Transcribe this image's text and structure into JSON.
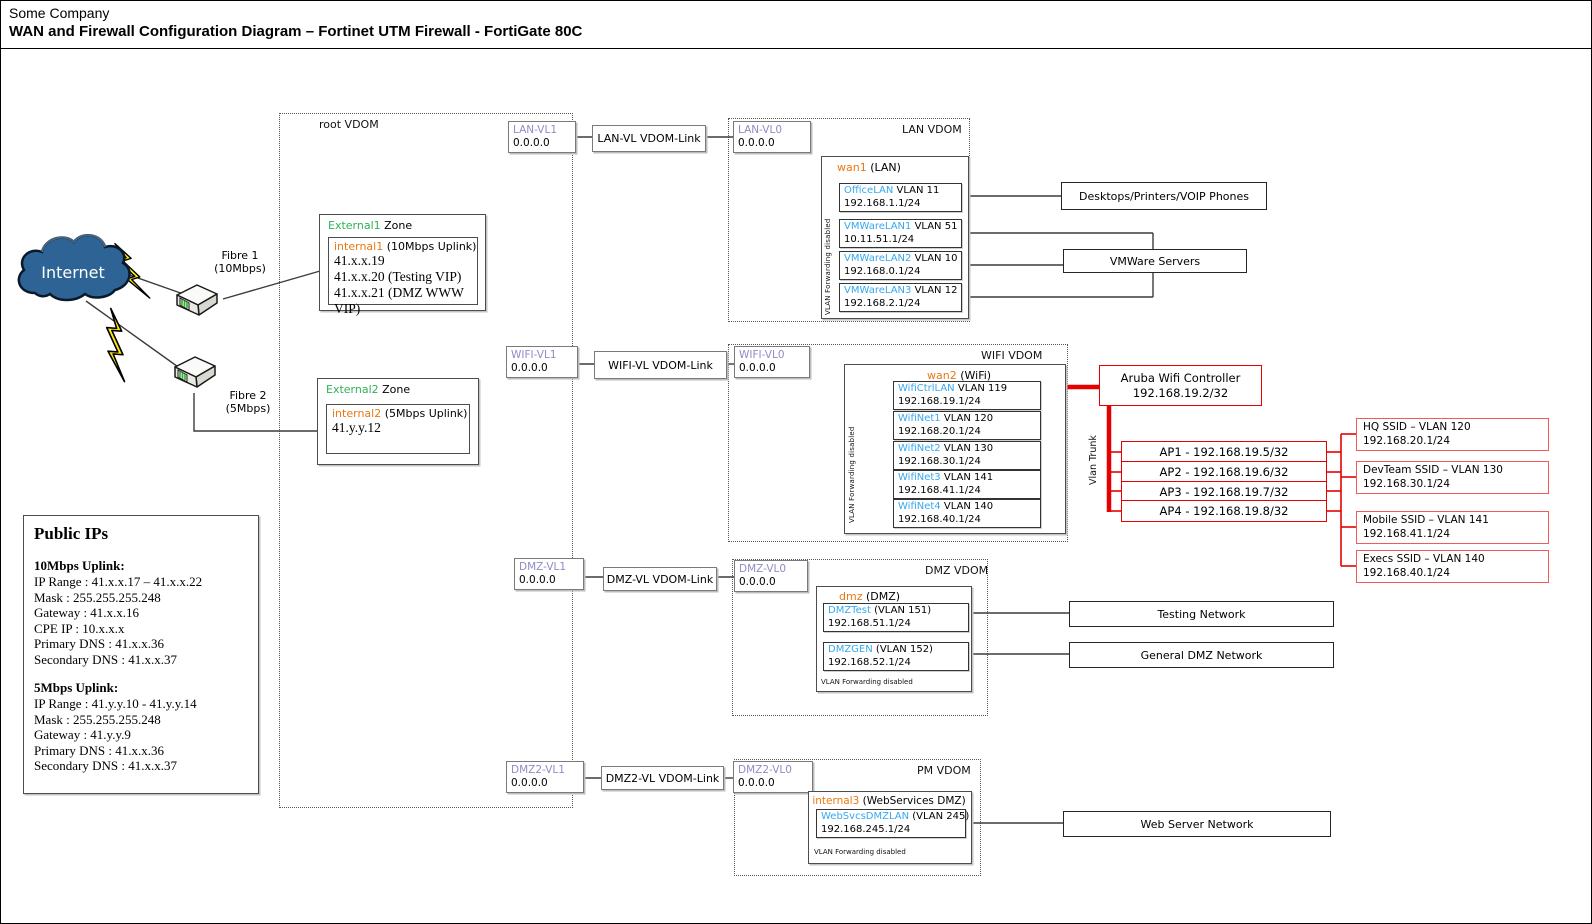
{
  "header": {
    "company": "Some Company",
    "title": "WAN and Firewall Configuration Diagram – Fortinet UTM Firewall - FortiGate 80C"
  },
  "internet": {
    "label": "Internet"
  },
  "wan_links": {
    "fibre1_line1": "Fibre 1",
    "fibre1_line2": "(10Mbps)",
    "fibre2_line1": "Fibre 2",
    "fibre2_line2": "(5Mbps)"
  },
  "root_vdom": {
    "label": "root VDOM",
    "external1": {
      "zone_name": "External1",
      "zone_word": "Zone",
      "iface": "internal1",
      "iface_note": "(10Mbps Uplink)",
      "ips": [
        "41.x.x.19",
        "41.x.x.20 (Testing VIP)",
        "41.x.x.21 (DMZ WWW VIP)"
      ]
    },
    "external2": {
      "zone_name": "External2",
      "zone_word": "Zone",
      "iface": "internal2",
      "iface_note": "(5Mbps Uplink)",
      "ips": [
        "41.y.y.12"
      ]
    }
  },
  "public_ips": {
    "title": "Public IPs",
    "sections": [
      {
        "heading": "10Mbps Uplink:",
        "lines": [
          "IP Range : 41.x.x.17 – 41.x.x.22",
          "Mask : 255.255.255.248",
          "Gateway : 41.x.x.16",
          "CPE IP : 10.x.x.x",
          "Primary DNS : 41.x.x.36",
          "Secondary DNS : 41.x.x.37"
        ]
      },
      {
        "heading": "5Mbps Uplink:",
        "lines": [
          "IP Range : 41.y.y.10 - 41.y.y.14",
          "Mask : 255.255.255.248",
          "Gateway : 41.y.y.9",
          "Primary DNS : 41.x.x.36",
          "Secondary DNS : 41.x.x.37"
        ]
      }
    ]
  },
  "vdom_links": {
    "lan": {
      "vl1": "LAN-VL1",
      "vl1_ip": "0.0.0.0",
      "link": "LAN-VL VDOM-Link",
      "vl0": "LAN-VL0",
      "vl0_ip": "0.0.0.0"
    },
    "wifi": {
      "vl1": "WIFI-VL1",
      "vl1_ip": "0.0.0.0",
      "link": "WIFI-VL VDOM-Link",
      "vl0": "WIFI-VL0",
      "vl0_ip": "0.0.0.0"
    },
    "dmz": {
      "vl1": "DMZ-VL1",
      "vl1_ip": "0.0.0.0",
      "link": "DMZ-VL VDOM-Link",
      "vl0": "DMZ-VL0",
      "vl0_ip": "0.0.0.0"
    },
    "dmz2": {
      "vl1": "DMZ2-VL1",
      "vl1_ip": "0.0.0.0",
      "link": "DMZ2-VL VDOM-Link",
      "vl0": "DMZ2-VL0",
      "vl0_ip": "0.0.0.0"
    }
  },
  "lan_vdom": {
    "label": "LAN VDOM",
    "iface": "wan1",
    "iface_note": "(LAN)",
    "forwarding_note": "VLAN Forwarding disabled",
    "vlans": [
      {
        "name": "OfficeLAN",
        "vlan": "VLAN 11",
        "ip": "192.168.1.1/24"
      },
      {
        "name": "VMWareLAN1",
        "vlan": "VLAN 51",
        "ip": "10.11.51.1/24"
      },
      {
        "name": "VMWareLAN2",
        "vlan": "VLAN 10",
        "ip": "192.168.0.1/24"
      },
      {
        "name": "VMWareLAN3",
        "vlan": "VLAN 12",
        "ip": "192.168.2.1/24"
      }
    ],
    "networks": {
      "desktops": "Desktops/Printers/VOIP Phones",
      "vmware": "VMWare Servers"
    }
  },
  "wifi_vdom": {
    "label": "WIFI VDOM",
    "iface": "wan2",
    "iface_note": "(WiFi)",
    "forwarding_note": "VLAN Forwarding disabled",
    "vlans": [
      {
        "name": "WifiCtrlLAN",
        "vlan": "VLAN 119",
        "ip": "192.168.19.1/24"
      },
      {
        "name": "WifiNet1",
        "vlan": "VLAN 120",
        "ip": "192.168.20.1/24"
      },
      {
        "name": "WifiNet2",
        "vlan": "VLAN 130",
        "ip": "192.168.30.1/24"
      },
      {
        "name": "WifiNet3",
        "vlan": "VLAN 141",
        "ip": "192.168.41.1/24"
      },
      {
        "name": "WifiNet4",
        "vlan": "VLAN 140",
        "ip": "192.168.40.1/24"
      }
    ],
    "controller": {
      "name": "Aruba Wifi Controller",
      "ip": "192.168.19.2/32"
    },
    "trunk_label": "Vlan Trunk",
    "aps": [
      "AP1 - 192.168.19.5/32",
      "AP2 - 192.168.19.6/32",
      "AP3 - 192.168.19.7/32",
      "AP4 - 192.168.19.8/32"
    ],
    "ssids": [
      {
        "name": "HQ SSID – VLAN 120",
        "ip": "192.168.20.1/24"
      },
      {
        "name": "DevTeam SSID – VLAN 130",
        "ip": "192.168.30.1/24"
      },
      {
        "name": "Mobile SSID – VLAN 141",
        "ip": "192.168.41.1/24"
      },
      {
        "name": "Execs SSID – VLAN 140",
        "ip": "192.168.40.1/24"
      }
    ]
  },
  "dmz_vdom": {
    "label": "DMZ VDOM",
    "iface": "dmz",
    "iface_note": "(DMZ)",
    "forwarding_note": "VLAN Forwarding disabled",
    "vlans": [
      {
        "name": "DMZTest",
        "vlan": "(VLAN 151)",
        "ip": "192.168.51.1/24"
      },
      {
        "name": "DMZGEN",
        "vlan": "(VLAN 152)",
        "ip": "192.168.52.1/24"
      }
    ],
    "networks": {
      "testing": "Testing Network",
      "general": "General DMZ Network"
    }
  },
  "pm_vdom": {
    "label": "PM VDOM",
    "iface": "internal3",
    "iface_note": "(WebServices DMZ)",
    "forwarding_note": "VLAN Forwarding disabled",
    "vlan": {
      "name": "WebSvcsDMZLAN",
      "vlan": "(VLAN 245)",
      "ip": "192.168.245.1/24"
    },
    "network": "Web Server Network"
  },
  "colors": {
    "red_accent": "#e60000",
    "ssid_red": "#f05a5a",
    "iface_orange": "#e87914",
    "vlan_cyan": "#35a8ef",
    "vl_purple": "#8f8cc6",
    "zone_green": "#2eb257",
    "cloud_blue": "#2e6395",
    "bolt_yellow": "#ffe714"
  }
}
